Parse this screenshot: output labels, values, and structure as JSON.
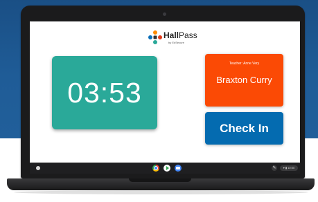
{
  "app": {
    "logo_text_bold": "Hall",
    "logo_text_regular": "Pass",
    "logo_subtext": "by EdSecure"
  },
  "timer": {
    "value": "03:53"
  },
  "student_card": {
    "teacher_label": "Teacher: Anne Very",
    "student_name": "Braxton Curry"
  },
  "actions": {
    "check_in_label": "Check In"
  },
  "shelf": {
    "clock": "▾ ▮ 10:00",
    "pen_glyph": "✎"
  },
  "colors": {
    "timer_bg": "#2aa999",
    "student_card_bg": "#fb4a05",
    "check_in_bg": "#046bb0",
    "page_bg_top": "#1f5c97"
  }
}
